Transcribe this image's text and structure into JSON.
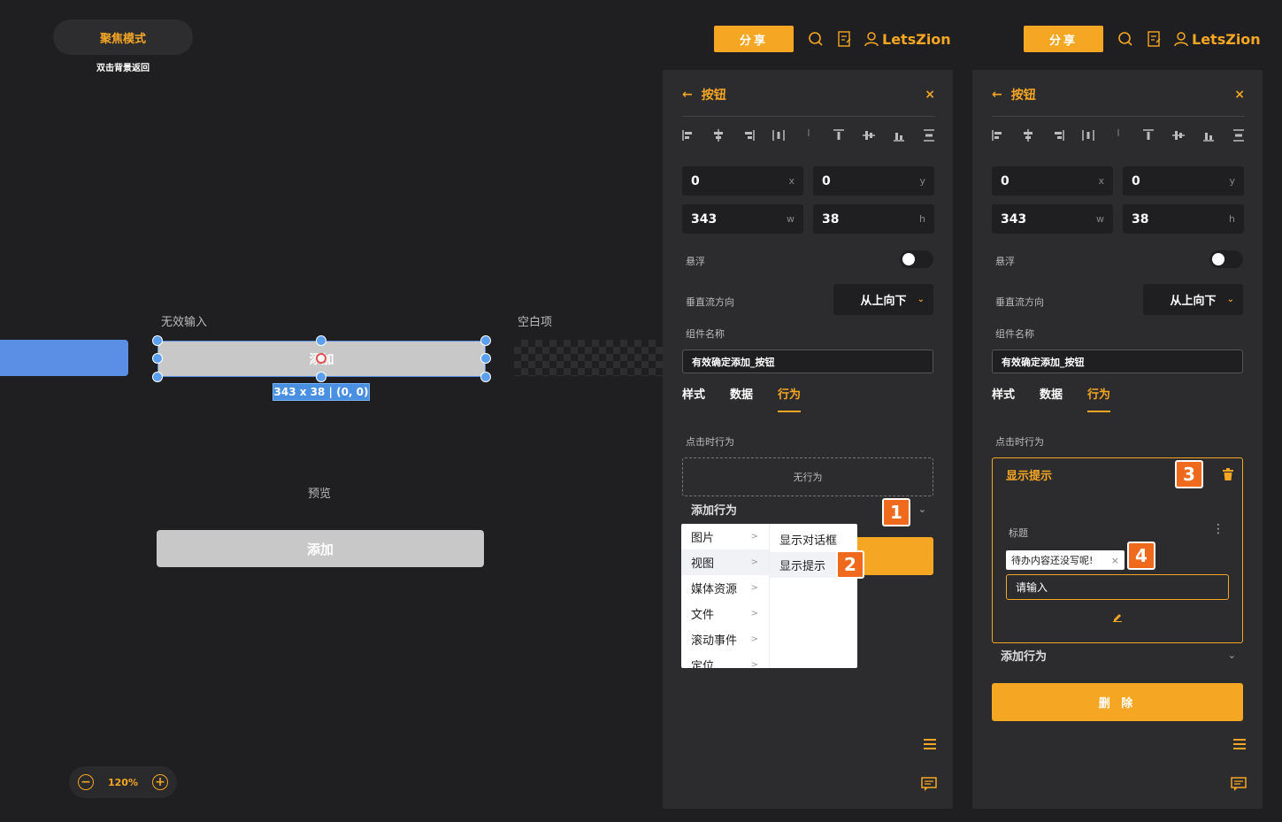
{
  "canvas": {
    "focus_mode": "聚焦模式",
    "focus_hint": "双击背景返回",
    "invalid_input_label": "无效输入",
    "blank_item_label": "空白项",
    "selected_button_text": "添加",
    "dimension_tag": "343 x 38 | (0, 0)",
    "preview_label": "预览",
    "preview_button_text": "添加",
    "zoom_level": "120%"
  },
  "topbar": {
    "share_label": "分享",
    "username": "LetsZion"
  },
  "panel": {
    "title": "按钮",
    "x_value": "0",
    "x_unit": "x",
    "y_value": "0",
    "y_unit": "y",
    "w_value": "343",
    "w_unit": "w",
    "h_value": "38",
    "h_unit": "h",
    "float_label": "悬浮",
    "vflow_label": "垂直流方向",
    "vflow_value": "从上向下",
    "comp_name_label": "组件名称",
    "comp_name_value": "有效确定添加_按钮",
    "tabs": [
      "样式",
      "数据",
      "行为"
    ],
    "click_action_label": "点击时行为",
    "no_action": "无行为",
    "add_action": "添加行为",
    "delete_label": "删 除"
  },
  "menu": {
    "col1": [
      "图片",
      "视图",
      "媒体资源",
      "文件",
      "滚动事件",
      "定位"
    ],
    "col2": [
      "显示对话框",
      "显示提示"
    ]
  },
  "action_card": {
    "title": "显示提示",
    "field_label": "标题",
    "tag_value": "待办内容还没写呢!",
    "input_placeholder": "请输入"
  },
  "badges": [
    "1",
    "2",
    "3",
    "4"
  ],
  "colors": {
    "accent": "#f5a623",
    "selection": "#5b8fe6",
    "badge": "#f06a1d",
    "panel": "#2c2c2e",
    "bg": "#1f1f21"
  }
}
